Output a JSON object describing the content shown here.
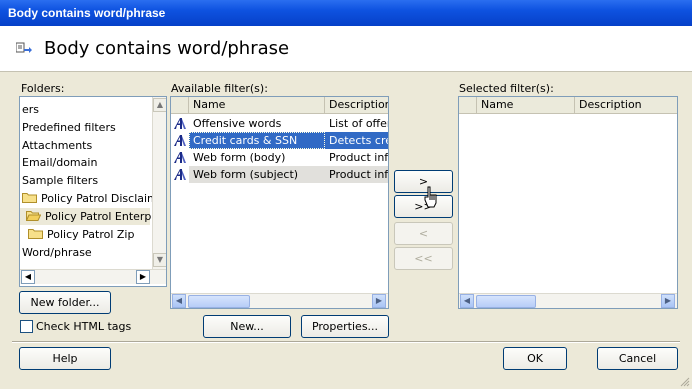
{
  "window": {
    "title": "Body contains word/phrase"
  },
  "header": {
    "title": "Body contains word/phrase",
    "icon": "rule-condition-icon"
  },
  "folders": {
    "label": "Folders:",
    "items": [
      {
        "label": "ers",
        "icon": ""
      },
      {
        "label": "Predefined filters",
        "icon": ""
      },
      {
        "label": "Attachments",
        "icon": ""
      },
      {
        "label": "Email/domain",
        "icon": ""
      },
      {
        "label": "Sample filters",
        "icon": ""
      },
      {
        "label": "Policy Patrol Disclaime",
        "icon": "folder-icon"
      },
      {
        "label": "Policy Patrol Enterpris",
        "icon": "folder-open-icon"
      },
      {
        "label": "Policy Patrol Zip",
        "icon": "folder-icon"
      },
      {
        "label": "Word/phrase",
        "icon": ""
      }
    ],
    "new_folder_button": "New folder..."
  },
  "available": {
    "label": "Available filter(s):",
    "columns": [
      "Name",
      "Description"
    ],
    "rows": [
      {
        "name": "Offensive words",
        "description": "List of offens"
      },
      {
        "name": "Credit cards & SSN",
        "description": "Detects credi"
      },
      {
        "name": "Web form (body)",
        "description": "Product info"
      },
      {
        "name": "Web form (subject)",
        "description": "Product info"
      }
    ],
    "new_button": "New...",
    "properties_button": "Properties..."
  },
  "transfer": {
    "add": ">",
    "add_all": ">>",
    "remove": "<",
    "remove_all": "<<"
  },
  "selected": {
    "label": "Selected filter(s):",
    "columns": [
      "Name",
      "Description"
    ],
    "rows": []
  },
  "options": {
    "check_html_tags": "Check HTML tags",
    "check_html_tags_checked": false
  },
  "footer": {
    "help": "Help",
    "ok": "OK",
    "cancel": "Cancel"
  },
  "colors": {
    "title_bar": "#0e52e0",
    "selection": "#316ac5",
    "dialog_bg": "#ece9d8"
  }
}
